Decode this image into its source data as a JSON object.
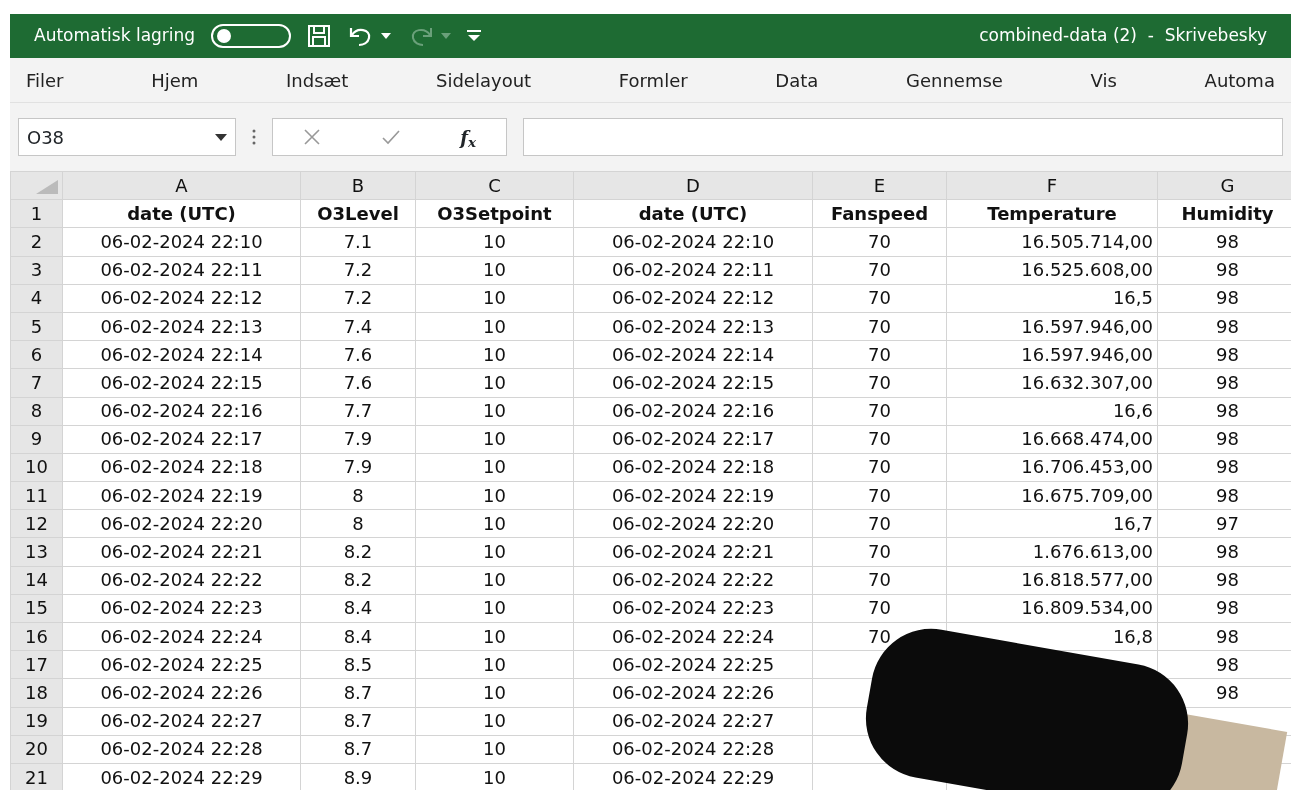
{
  "title_bar": {
    "autosave_label": "Automatisk lagring",
    "autosave_on": false,
    "redo_disabled": true,
    "document_title": "combined-data (2)  -  Skrivebesky"
  },
  "ribbon_tabs": [
    "Filer",
    "Hjem",
    "Indsæt",
    "Sidelayout",
    "Formler",
    "Data",
    "Gennemse",
    "Vis",
    "Automa"
  ],
  "formula_bar": {
    "name_box": "O38",
    "function_label": "f$_{x}$"
  },
  "sheet": {
    "column_letters": [
      "A",
      "B",
      "C",
      "D",
      "E",
      "F",
      "G"
    ],
    "rows": [
      {
        "number": "1",
        "kind": "header",
        "cells": [
          "date (UTC)",
          "O3Level",
          "O3Setpoint",
          "date (UTC)",
          "Fanspeed",
          "Temperature",
          "Humidity"
        ]
      },
      {
        "number": "2",
        "kind": "data",
        "cells": [
          "06-02-2024 22:10",
          "7.1",
          "10",
          "06-02-2024 22:10",
          "70",
          "16.505.714,00",
          "98"
        ]
      },
      {
        "number": "3",
        "kind": "data",
        "cells": [
          "06-02-2024 22:11",
          "7.2",
          "10",
          "06-02-2024 22:11",
          "70",
          "16.525.608,00",
          "98"
        ]
      },
      {
        "number": "4",
        "kind": "data",
        "cells": [
          "06-02-2024 22:12",
          "7.2",
          "10",
          "06-02-2024 22:12",
          "70",
          "16,5",
          "98"
        ]
      },
      {
        "number": "5",
        "kind": "data",
        "cells": [
          "06-02-2024 22:13",
          "7.4",
          "10",
          "06-02-2024 22:13",
          "70",
          "16.597.946,00",
          "98"
        ]
      },
      {
        "number": "6",
        "kind": "data",
        "cells": [
          "06-02-2024 22:14",
          "7.6",
          "10",
          "06-02-2024 22:14",
          "70",
          "16.597.946,00",
          "98"
        ]
      },
      {
        "number": "7",
        "kind": "data",
        "cells": [
          "06-02-2024 22:15",
          "7.6",
          "10",
          "06-02-2024 22:15",
          "70",
          "16.632.307,00",
          "98"
        ]
      },
      {
        "number": "8",
        "kind": "data",
        "cells": [
          "06-02-2024 22:16",
          "7.7",
          "10",
          "06-02-2024 22:16",
          "70",
          "16,6",
          "98"
        ]
      },
      {
        "number": "9",
        "kind": "data",
        "cells": [
          "06-02-2024 22:17",
          "7.9",
          "10",
          "06-02-2024 22:17",
          "70",
          "16.668.474,00",
          "98"
        ]
      },
      {
        "number": "10",
        "kind": "data",
        "cells": [
          "06-02-2024 22:18",
          "7.9",
          "10",
          "06-02-2024 22:18",
          "70",
          "16.706.453,00",
          "98"
        ]
      },
      {
        "number": "11",
        "kind": "data",
        "cells": [
          "06-02-2024 22:19",
          "8",
          "10",
          "06-02-2024 22:19",
          "70",
          "16.675.709,00",
          "98"
        ]
      },
      {
        "number": "12",
        "kind": "data",
        "cells": [
          "06-02-2024 22:20",
          "8",
          "10",
          "06-02-2024 22:20",
          "70",
          "16,7",
          "97"
        ]
      },
      {
        "number": "13",
        "kind": "data",
        "cells": [
          "06-02-2024 22:21",
          "8.2",
          "10",
          "06-02-2024 22:21",
          "70",
          "1.676.613,00",
          "98"
        ]
      },
      {
        "number": "14",
        "kind": "data",
        "cells": [
          "06-02-2024 22:22",
          "8.2",
          "10",
          "06-02-2024 22:22",
          "70",
          "16.818.577,00",
          "98"
        ]
      },
      {
        "number": "15",
        "kind": "data",
        "cells": [
          "06-02-2024 22:23",
          "8.4",
          "10",
          "06-02-2024 22:23",
          "70",
          "16.809.534,00",
          "98"
        ]
      },
      {
        "number": "16",
        "kind": "data",
        "cells": [
          "06-02-2024 22:24",
          "8.4",
          "10",
          "06-02-2024 22:24",
          "70",
          "16,8",
          "98"
        ]
      },
      {
        "number": "17",
        "kind": "data",
        "cells": [
          "06-02-2024 22:25",
          "8.5",
          "10",
          "06-02-2024 22:25",
          null,
          null,
          "98"
        ]
      },
      {
        "number": "18",
        "kind": "data",
        "cells": [
          "06-02-2024 22:26",
          "8.7",
          "10",
          "06-02-2024 22:26",
          null,
          null,
          "98"
        ]
      },
      {
        "number": "19",
        "kind": "data",
        "cells": [
          "06-02-2024 22:27",
          "8.7",
          "10",
          "06-02-2024 22:27",
          null,
          null,
          null
        ]
      },
      {
        "number": "20",
        "kind": "data",
        "cells": [
          "06-02-2024 22:28",
          "8.7",
          "10",
          "06-02-2024 22:28",
          null,
          null,
          null
        ]
      },
      {
        "number": "21",
        "kind": "data",
        "cells": [
          "06-02-2024 22:29",
          "8.9",
          "10",
          "06-02-2024 22:29",
          null,
          null,
          null
        ]
      }
    ]
  }
}
